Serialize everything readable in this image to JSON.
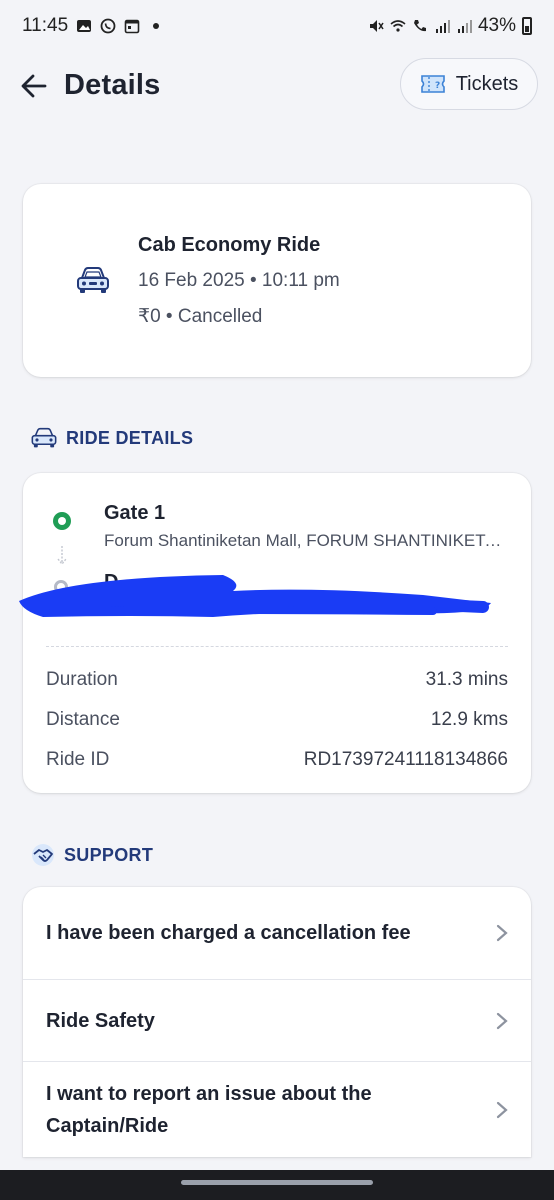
{
  "status_bar": {
    "time": "11:45",
    "battery": "43%"
  },
  "header": {
    "title": "Details",
    "tickets_label": "Tickets"
  },
  "summary": {
    "title": "Cab Economy Ride",
    "datetime": "16 Feb 2025 • 10:11 pm",
    "fare_status": "₹0 • Cancelled"
  },
  "ride_details": {
    "heading": "RIDE DETAILS",
    "pickup_name": "Gate 1",
    "pickup_address": "Forum Shantiniketan Mall, FORUM SHANTINIKETAN",
    "drop_name": "D",
    "rows": [
      {
        "label": "Duration",
        "value": "31.3 mins"
      },
      {
        "label": "Distance",
        "value": "12.9 kms"
      },
      {
        "label": "Ride ID",
        "value": "RD17397241118134866"
      }
    ]
  },
  "support": {
    "heading": "SUPPORT",
    "items": [
      {
        "label": "I have been charged a cancellation fee"
      },
      {
        "label": "Ride Safety"
      },
      {
        "label": "I want to report an issue about the Captain/Ride"
      }
    ]
  },
  "colors": {
    "accent": "#233a7a",
    "pickup": "#1f9d55",
    "redaction": "#1a3cf5"
  }
}
